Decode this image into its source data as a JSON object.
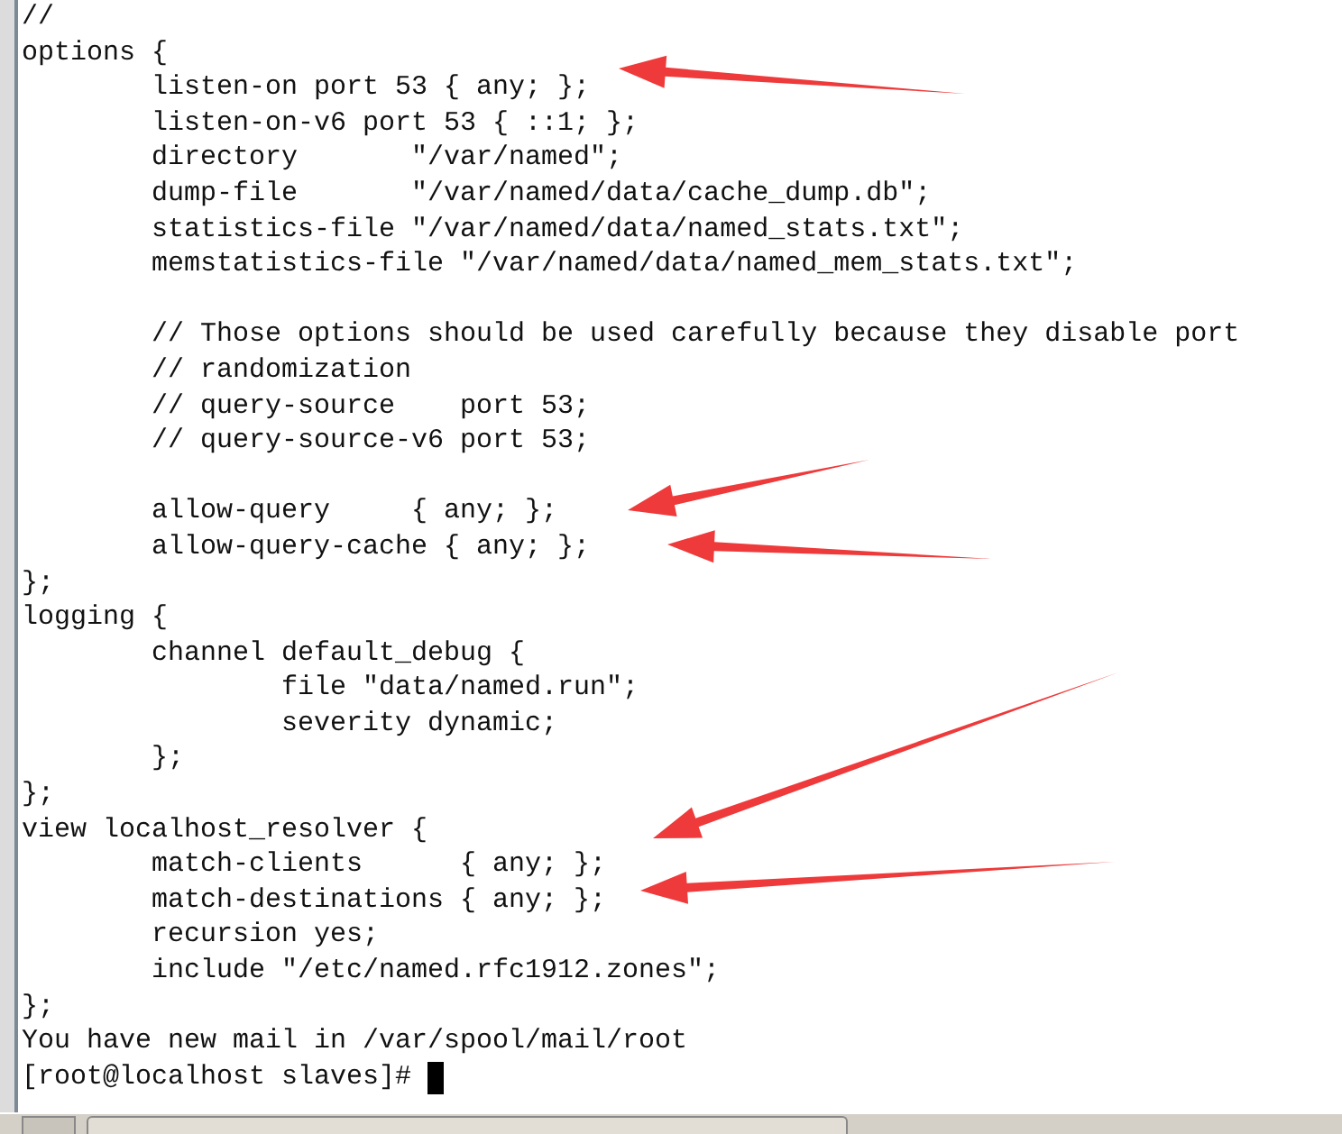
{
  "terminal": {
    "lines": [
      {
        "kind": "text",
        "text": "//"
      },
      {
        "kind": "text",
        "text": "options {"
      },
      {
        "kind": "text",
        "text": "        listen-on port 53 { any; };"
      },
      {
        "kind": "text",
        "text": "        listen-on-v6 port 53 { ::1; };"
      },
      {
        "kind": "text",
        "text": "        directory       \"/var/named\";"
      },
      {
        "kind": "text",
        "text": "        dump-file       \"/var/named/data/cache_dump.db\";"
      },
      {
        "kind": "text",
        "text": "        statistics-file \"/var/named/data/named_stats.txt\";"
      },
      {
        "kind": "text",
        "text": "        memstatistics-file \"/var/named/data/named_mem_stats.txt\";"
      },
      {
        "kind": "blank"
      },
      {
        "kind": "text",
        "text": "        // Those options should be used carefully because they disable port"
      },
      {
        "kind": "text",
        "text": "        // randomization"
      },
      {
        "kind": "text",
        "text": "        // query-source    port 53;"
      },
      {
        "kind": "text",
        "text": "        // query-source-v6 port 53;"
      },
      {
        "kind": "blank"
      },
      {
        "kind": "text",
        "text": "        allow-query     { any; };"
      },
      {
        "kind": "text",
        "text": "        allow-query-cache { any; };"
      },
      {
        "kind": "text",
        "text": "};"
      },
      {
        "kind": "text",
        "text": "logging {"
      },
      {
        "kind": "text",
        "text": "        channel default_debug {"
      },
      {
        "kind": "text",
        "text": "                file \"data/named.run\";"
      },
      {
        "kind": "text",
        "text": "                severity dynamic;"
      },
      {
        "kind": "text",
        "text": "        };"
      },
      {
        "kind": "text",
        "text": "};"
      },
      {
        "kind": "text",
        "text": "view localhost_resolver {"
      },
      {
        "kind": "text",
        "text": "        match-clients      { any; };"
      },
      {
        "kind": "text",
        "text": "        match-destinations { any; };"
      },
      {
        "kind": "text",
        "text": "        recursion yes;"
      },
      {
        "kind": "text",
        "text": "        include \"/etc/named.rfc1912.zones\";"
      },
      {
        "kind": "text",
        "text": "};"
      },
      {
        "kind": "text",
        "text": "You have new mail in /var/spool/mail/root"
      }
    ],
    "prompt": "[root@localhost slaves]#",
    "cursor": true
  }
}
